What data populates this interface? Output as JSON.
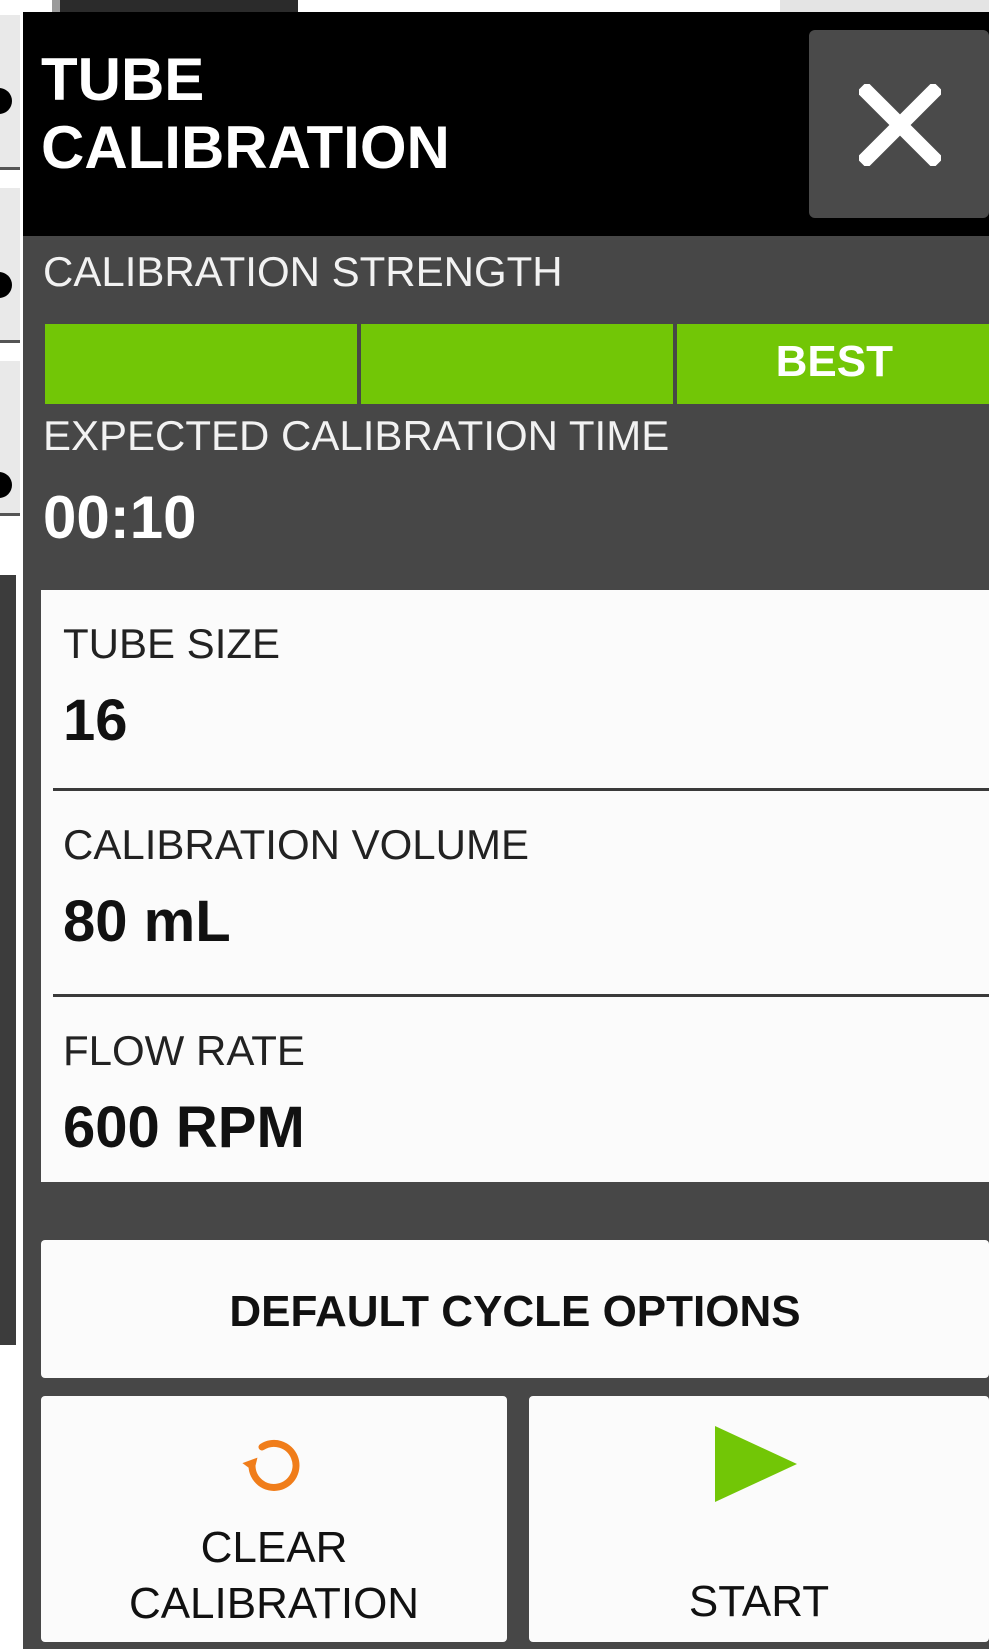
{
  "dialog": {
    "title": "TUBE\nCALIBRATION",
    "close_icon": "close-icon"
  },
  "calibration_strength": {
    "label": "CALIBRATION STRENGTH",
    "level_text": "BEST",
    "segments_filled": 3,
    "segments_total": 3,
    "bar_color": "#72c606"
  },
  "expected_time": {
    "label": "EXPECTED CALIBRATION TIME",
    "value": "00:10"
  },
  "settings": [
    {
      "label": "TUBE SIZE",
      "value": "16"
    },
    {
      "label": "CALIBRATION VOLUME",
      "value": "80 mL"
    },
    {
      "label": "FLOW RATE",
      "value": "600 RPM"
    }
  ],
  "buttons": {
    "default_cycle_options": "DEFAULT CYCLE OPTIONS",
    "clear_calibration": "CLEAR\nCALIBRATION",
    "clear_icon": "refresh-icon",
    "clear_icon_color": "#f07d1a",
    "start": "START",
    "start_icon": "play-icon",
    "start_icon_color": "#72c606"
  }
}
